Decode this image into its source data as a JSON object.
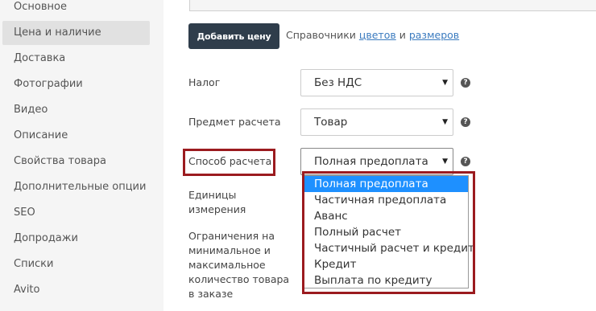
{
  "sidebar": {
    "items": [
      {
        "label": "Основное"
      },
      {
        "label": "Цена и наличие",
        "active": true
      },
      {
        "label": "Доставка"
      },
      {
        "label": "Фотографии"
      },
      {
        "label": "Видео"
      },
      {
        "label": "Описание"
      },
      {
        "label": "Свойства товара"
      },
      {
        "label": "Дополнительные опции"
      },
      {
        "label": "SEO"
      },
      {
        "label": "Допродажи"
      },
      {
        "label": "Списки"
      },
      {
        "label": "Avito"
      }
    ]
  },
  "toolbar": {
    "add_price_label": "Добавить цену",
    "refs_prefix": "Справочники",
    "refs_colors": "цветов",
    "refs_and": "и",
    "refs_sizes": "размеров"
  },
  "form": {
    "tax": {
      "label": "Налог",
      "value": "Без НДС"
    },
    "subject": {
      "label": "Предмет расчета",
      "value": "Товар"
    },
    "method": {
      "label": "Способ расчета",
      "value": "Полная предоплата"
    },
    "units": {
      "label_line1": "Единицы",
      "label_line2": "измерения"
    },
    "limits": {
      "line1": "Ограничения на",
      "line2": "минимальное и",
      "line3": "максимальное",
      "line4": "количество товара",
      "line5": "в заказе"
    },
    "help_glyph": "?"
  },
  "dropdown": {
    "options": [
      "Полная предоплата",
      "Частичная предоплата",
      "Аванс",
      "Полный расчет",
      "Частичный расчет и кредит",
      "Кредит",
      "Выплата по кредиту"
    ],
    "selected_index": 0
  },
  "colors": {
    "highlight": "#9b1b1f",
    "selected_bg": "#1e90ff",
    "button_bg": "#2f3d4b",
    "link": "#3b7bbf"
  }
}
